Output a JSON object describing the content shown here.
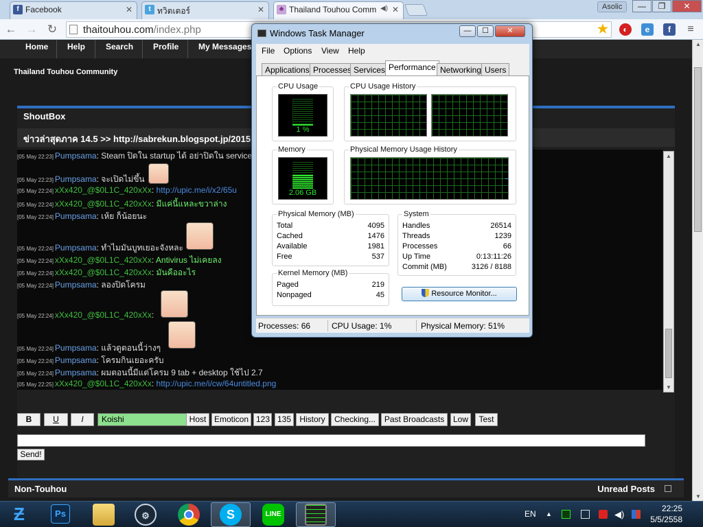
{
  "browser": {
    "tabs": [
      {
        "label": "Facebook",
        "icon": "facebook-icon"
      },
      {
        "label": "ทวิตเตอร์",
        "icon": "twitter-icon"
      },
      {
        "label": "Thailand Touhou Comm",
        "icon": "touhou-icon"
      }
    ],
    "profile_name": "Asolic",
    "url_host": "thaitouhou.com",
    "url_path": "/index.php"
  },
  "site": {
    "nav": [
      "Home",
      "Help",
      "Search",
      "Profile",
      "My Messages"
    ],
    "title": "Thailand Touhou Community",
    "shoutbox": {
      "header": "ShoutBox",
      "news": "ข่าวล่าสุดภาค 14.5 >> http://sabrekun.blogspot.jp/2015",
      "messages": [
        {
          "time": "[05 May 22:23]",
          "user": "Pumpsama",
          "user_color": "#6aa1e6",
          "sep": ": ",
          "text": "Steam ปิดใน startup ได้ อย่าปิดใน service",
          "text_style": "plain"
        },
        {
          "time": "[05 May 22:23]",
          "user": "Pumpsama",
          "user_color": "#6aa1e6",
          "sep": ": ",
          "text": "จะเปิดไม่ขึ้น",
          "text_style": "plain"
        },
        {
          "time": "[05 May 22:24]",
          "user": "xXx420_@$0L1C_420xXx",
          "user_color": "#3fbf3f",
          "sep": ": ",
          "text": "http://upic.me/i/x2/65u",
          "text_style": "link"
        },
        {
          "time": "[05 May 22:24]",
          "user": "xXx420_@$0L1C_420xXx",
          "user_color": "#3fbf3f",
          "sep": ": ",
          "text": "มีแค่นี้แหละขวาล่าง",
          "text_style": "lime"
        },
        {
          "time": "[05 May 22:24]",
          "user": "Pumpsama",
          "user_color": "#6aa1e6",
          "sep": ": ",
          "text": "เห้ย ก็น้อยนะ",
          "text_style": "plain"
        },
        {
          "time": "[05 May 22:24]",
          "user": "Pumpsama",
          "user_color": "#6aa1e6",
          "sep": ": ",
          "text": "ทำไมมันบูทเยอะจังหละ",
          "text_style": "plain"
        },
        {
          "time": "[05 May 22:24]",
          "user": "xXx420_@$0L1C_420xXx",
          "user_color": "#3fbf3f",
          "sep": ": ",
          "text": "Antivirus ไม่เคยลง",
          "text_style": "lime"
        },
        {
          "time": "[05 May 22:24]",
          "user": "xXx420_@$0L1C_420xXx",
          "user_color": "#3fbf3f",
          "sep": ": ",
          "text": "มันคืออะไร",
          "text_style": "lime"
        },
        {
          "time": "[05 May 22:24]",
          "user": "Pumpsama",
          "user_color": "#6aa1e6",
          "sep": ": ",
          "text": "ลองปิดโครม",
          "text_style": "plain"
        },
        {
          "time": "[05 May 22:24]",
          "user": "xXx420_@$0L1C_420xXx",
          "user_color": "#3fbf3f",
          "sep": ":",
          "text": "",
          "text_style": "plain"
        },
        {
          "time": "[05 May 22:24]",
          "user": "Pumpsama",
          "user_color": "#6aa1e6",
          "sep": ": ",
          "text": "แล้วดูตอนนี้ว่างๆ",
          "text_style": "plain"
        },
        {
          "time": "[05 May 22:24]",
          "user": "Pumpsama",
          "user_color": "#6aa1e6",
          "sep": ": ",
          "text": "โครมกินเยอะครับ",
          "text_style": "plain"
        },
        {
          "time": "[05 May 22:24]",
          "user": "Pumpsama",
          "user_color": "#6aa1e6",
          "sep": ": ",
          "text": "ผมตอนนี้มีแต่โครม 9 tab + desktop ใช้ไป 2.7",
          "text_style": "plain"
        },
        {
          "time": "[05 May 22:25]",
          "user": "xXx420_@$0L1C_420xXx",
          "user_color": "#3fbf3f",
          "sep": ": ",
          "text": "http://upic.me/i/cw/64untitled.png",
          "text_style": "link"
        }
      ],
      "toolbar": [
        "B",
        "U",
        "I",
        "Host",
        "Emoticon",
        "123",
        "135",
        "History",
        "Checking...",
        "Past Broadcasts",
        "Low",
        "Test"
      ],
      "color_select": "Koishi",
      "send_label": "Send!"
    },
    "bottom_left": "Non-Touhou",
    "bottom_right": "Unread Posts"
  },
  "taskmanager": {
    "title": "Windows Task Manager",
    "menu": [
      "File",
      "Options",
      "View",
      "Help"
    ],
    "tabs": [
      "Applications",
      "Processes",
      "Services",
      "Performance",
      "Networking",
      "Users"
    ],
    "active_tab": "Performance",
    "cpu_usage_label": "CPU Usage",
    "cpu_usage_value": "1 %",
    "cpu_history_label": "CPU Usage History",
    "memory_label": "Memory",
    "memory_value": "2.06 GB",
    "mem_history_label": "Physical Memory Usage History",
    "physical": {
      "label": "Physical Memory (MB)",
      "rows": [
        [
          "Total",
          "4095"
        ],
        [
          "Cached",
          "1476"
        ],
        [
          "Available",
          "1981"
        ],
        [
          "Free",
          "537"
        ]
      ]
    },
    "kernel": {
      "label": "Kernel Memory (MB)",
      "rows": [
        [
          "Paged",
          "219"
        ],
        [
          "Nonpaged",
          "45"
        ]
      ]
    },
    "system": {
      "label": "System",
      "rows": [
        [
          "Handles",
          "26514"
        ],
        [
          "Threads",
          "1239"
        ],
        [
          "Processes",
          "66"
        ],
        [
          "Up Time",
          "0:13:11:26"
        ],
        [
          "Commit (MB)",
          "3126 / 8188"
        ]
      ]
    },
    "resource_monitor": "Resource Monitor...",
    "status": {
      "processes": "Processes: 66",
      "cpu": "CPU Usage: 1%",
      "memory": "Physical Memory: 51%"
    }
  },
  "taskbar": {
    "language": "EN",
    "time": "22:25",
    "date": "5/5/2558",
    "apps": [
      "start-icon",
      "photoshop-icon",
      "explorer-icon",
      "steam-icon",
      "chrome-icon",
      "skype-icon",
      "line-icon",
      "task-manager-icon"
    ]
  }
}
